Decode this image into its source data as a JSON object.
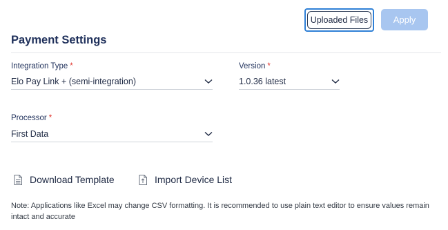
{
  "toolbar": {
    "uploaded_files_label": "Uploaded Files",
    "apply_label": "Apply"
  },
  "section": {
    "title": "Payment Settings"
  },
  "fields": {
    "integration_type": {
      "label": "Integration Type",
      "required_mark": "*",
      "value": "Elo Pay Link + (semi-integration)"
    },
    "version": {
      "label": "Version",
      "required_mark": "*",
      "value": "1.0.36 latest"
    },
    "processor": {
      "label": "Processor",
      "required_mark": "*",
      "value": "First Data"
    }
  },
  "actions": {
    "download_template": "Download Template",
    "import_device_list": "Import Device List"
  },
  "note": "Note: Applications like Excel may change CSV formatting. It is recommended to use plain text editor to ensure values remain intact and accurate",
  "colors": {
    "accent": "#2e7fd6",
    "apply_disabled": "#a8c6f0",
    "title": "#1e2f5a",
    "required": "#e0322b"
  },
  "icons": {
    "dropdown": "chevron-down-icon",
    "download": "document-icon",
    "import": "file-upload-icon"
  }
}
